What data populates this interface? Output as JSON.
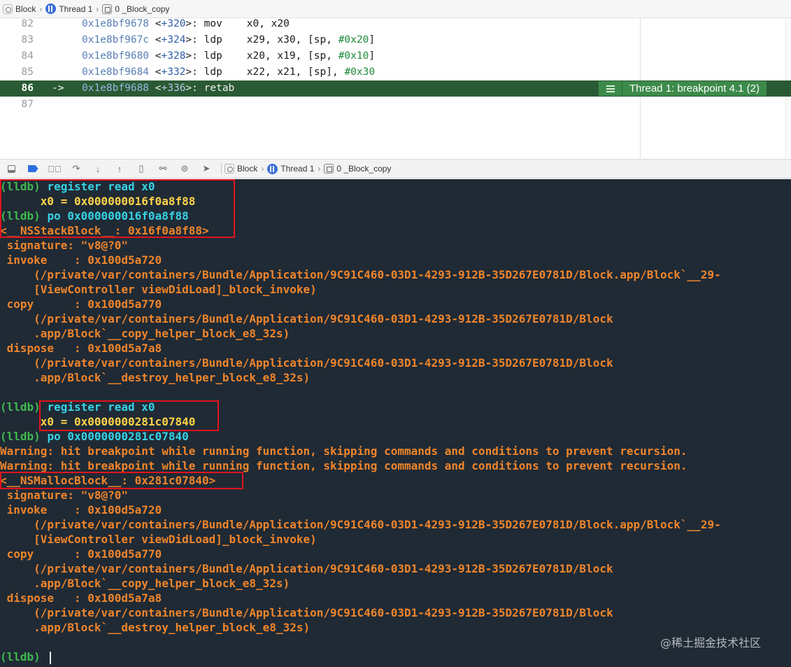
{
  "jumpbar": {
    "crumbs": [
      "Block",
      "Thread 1",
      "0 _Block_copy"
    ]
  },
  "editor": {
    "lines": [
      {
        "num": "82",
        "arrow": "",
        "addr": "0x1e8bf9678",
        "off": "+320",
        "op": "mov",
        "args": "x0, x20",
        "imm": "",
        "tail": ""
      },
      {
        "num": "83",
        "arrow": "",
        "addr": "0x1e8bf967c",
        "off": "+324",
        "op": "ldp",
        "args": "x29, x30, [sp, ",
        "imm": "#0x20",
        "tail": "]"
      },
      {
        "num": "84",
        "arrow": "",
        "addr": "0x1e8bf9680",
        "off": "+328",
        "op": "ldp",
        "args": "x20, x19, [sp, ",
        "imm": "#0x10",
        "tail": "]"
      },
      {
        "num": "85",
        "arrow": "",
        "addr": "0x1e8bf9684",
        "off": "+332",
        "op": "ldp",
        "args": "x22, x21, [sp], ",
        "imm": "#0x30",
        "tail": ""
      },
      {
        "num": "86",
        "arrow": "->",
        "addr": "0x1e8bf9688",
        "off": "+336",
        "op": "retab",
        "args": "",
        "imm": "",
        "tail": ""
      },
      {
        "num": "87",
        "arrow": "",
        "addr": "",
        "off": "",
        "op": "",
        "args": "",
        "imm": "",
        "tail": ""
      }
    ],
    "breakpoint_label": "Thread 1: breakpoint 4.1 (2)"
  },
  "debugbar": {
    "crumbs": [
      "Block",
      "Thread 1",
      "0 _Block_copy"
    ]
  },
  "console": {
    "prompt": "(lldb)",
    "lines": [
      {
        "type": "cmd",
        "text": "register read x0"
      },
      {
        "type": "out2",
        "text": "      x0 = 0x000000016f0a8f88"
      },
      {
        "type": "cmd",
        "text": "po 0x000000016f0a8f88"
      },
      {
        "type": "out",
        "text": "<__NSStackBlock__: 0x16f0a8f88>"
      },
      {
        "type": "out",
        "text": " signature: \"v8@?0\""
      },
      {
        "type": "out",
        "text": " invoke    : 0x100d5a720"
      },
      {
        "type": "out",
        "text": "     (/private/var/containers/Bundle/Application/9C91C460-03D1-4293-912B-35D267E0781D/Block.app/Block`__29-"
      },
      {
        "type": "out",
        "text": "     [ViewController viewDidLoad]_block_invoke)"
      },
      {
        "type": "out",
        "text": " copy      : 0x100d5a770"
      },
      {
        "type": "out",
        "text": "     (/private/var/containers/Bundle/Application/9C91C460-03D1-4293-912B-35D267E0781D/Block"
      },
      {
        "type": "out",
        "text": "     .app/Block`__copy_helper_block_e8_32s)"
      },
      {
        "type": "out",
        "text": " dispose   : 0x100d5a7a8"
      },
      {
        "type": "out",
        "text": "     (/private/var/containers/Bundle/Application/9C91C460-03D1-4293-912B-35D267E0781D/Block"
      },
      {
        "type": "out",
        "text": "     .app/Block`__destroy_helper_block_e8_32s)"
      },
      {
        "type": "blank",
        "text": ""
      },
      {
        "type": "cmd",
        "text": "register read x0"
      },
      {
        "type": "out2",
        "text": "      x0 = 0x0000000281c07840"
      },
      {
        "type": "cmd",
        "text": "po 0x0000000281c07840"
      },
      {
        "type": "out",
        "text": "Warning: hit breakpoint while running function, skipping commands and conditions to prevent recursion."
      },
      {
        "type": "out",
        "text": "Warning: hit breakpoint while running function, skipping commands and conditions to prevent recursion."
      },
      {
        "type": "out",
        "text": "<__NSMallocBlock__: 0x281c07840>"
      },
      {
        "type": "out",
        "text": " signature: \"v8@?0\""
      },
      {
        "type": "out",
        "text": " invoke    : 0x100d5a720"
      },
      {
        "type": "out",
        "text": "     (/private/var/containers/Bundle/Application/9C91C460-03D1-4293-912B-35D267E0781D/Block.app/Block`__29-"
      },
      {
        "type": "out",
        "text": "     [ViewController viewDidLoad]_block_invoke)"
      },
      {
        "type": "out",
        "text": " copy      : 0x100d5a770"
      },
      {
        "type": "out",
        "text": "     (/private/var/containers/Bundle/Application/9C91C460-03D1-4293-912B-35D267E0781D/Block"
      },
      {
        "type": "out",
        "text": "     .app/Block`__copy_helper_block_e8_32s)"
      },
      {
        "type": "out",
        "text": " dispose   : 0x100d5a7a8"
      },
      {
        "type": "out",
        "text": "     (/private/var/containers/Bundle/Application/9C91C460-03D1-4293-912B-35D267E0781D/Block"
      },
      {
        "type": "out",
        "text": "     .app/Block`__destroy_helper_block_e8_32s)"
      },
      {
        "type": "blank",
        "text": ""
      },
      {
        "type": "prompt",
        "text": ""
      }
    ],
    "watermark": "@稀土掘金技术社区"
  },
  "colors": {
    "prompt": "#3fb950",
    "command": "#37d2e6",
    "output": "#f0852b",
    "highlight_box": "#e0141f",
    "current_line": "#2a5a33"
  }
}
